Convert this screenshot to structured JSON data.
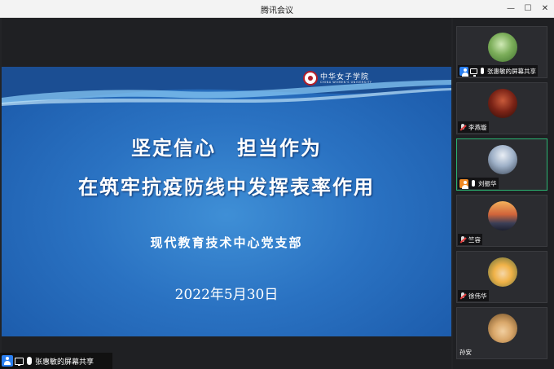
{
  "window": {
    "title": "腾讯会议"
  },
  "controls": {
    "minimize": "—",
    "maximize": "☐",
    "close": "✕"
  },
  "slide": {
    "school_name": "中华女子学院",
    "school_name_en": "CHINA WOMEN'S UNIVERSITY",
    "title_line1": "坚定信心　担当作为",
    "title_line2": "在筑牢抗疫防线中发挥表率作用",
    "department": "现代教育技术中心党支部",
    "date": "2022年5月30日"
  },
  "share_bar": {
    "label": "张惠敏的屏幕共享"
  },
  "participants": [
    {
      "name": "张惠敏的屏幕共享",
      "avatar": "green-leaf-avatar",
      "sharing": true,
      "muted": false
    },
    {
      "name": "李燕璇",
      "avatar": "dark-red-avatar",
      "sharing": false,
      "muted": true
    },
    {
      "name": "刘振华",
      "avatar": "tree-sky-avatar",
      "sharing": false,
      "muted": false,
      "speaking": true
    },
    {
      "name": "竺容",
      "avatar": "sunset-avatar",
      "sharing": false,
      "muted": true
    },
    {
      "name": "徐伟华",
      "avatar": "cartoon-ninja-avatar",
      "sharing": false,
      "muted": true
    },
    {
      "name": "孙安",
      "avatar": "cartoon-pirate-avatar",
      "sharing": false,
      "muted": false
    }
  ],
  "colors": {
    "accent": "#2b7ff0",
    "speaking_border": "#2bb673",
    "slide_blue": "#2a72c2",
    "muted_red": "#e23b3b"
  }
}
